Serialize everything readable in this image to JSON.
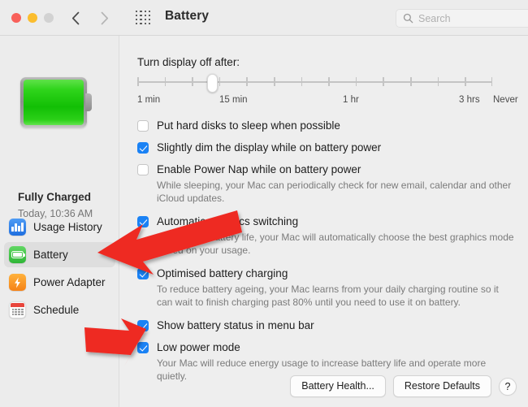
{
  "window": {
    "title": "Battery",
    "traffic_lights": [
      "close",
      "minimise",
      "zoom"
    ],
    "back_icon": "chevron-left-icon",
    "forward_icon": "chevron-right-icon",
    "grid_icon": "show-all-preferences-grid-icon",
    "search": {
      "placeholder": "Search",
      "value": "",
      "icon": "search-icon"
    }
  },
  "sidebar": {
    "battery_icon": "battery-full-green-icon",
    "status_title": "Fully Charged",
    "status_time": "Today, 10:36 AM",
    "items": [
      {
        "label": "Usage History",
        "icon": "usage-history-chart-icon",
        "selected": false
      },
      {
        "label": "Battery",
        "icon": "battery-icon",
        "selected": true
      },
      {
        "label": "Power Adapter",
        "icon": "power-adapter-bolt-icon",
        "selected": false
      },
      {
        "label": "Schedule",
        "icon": "schedule-calendar-icon",
        "selected": false
      }
    ]
  },
  "main": {
    "slider": {
      "label": "Turn display off after:",
      "tick_labels": [
        "1 min",
        "15 min",
        "1 hr",
        "3 hrs",
        "Never"
      ],
      "tick_count": 14,
      "thumb_position_percent": 21,
      "value": "15 min"
    },
    "options": [
      {
        "label": "Put hard disks to sleep when possible",
        "checked": false,
        "help": ""
      },
      {
        "label": "Slightly dim the display while on battery power",
        "checked": true,
        "help": ""
      },
      {
        "label": "Enable Power Nap while on battery power",
        "checked": false,
        "help": "While sleeping, your Mac can periodically check for new email, calendar and other iCloud updates."
      },
      {
        "label": "Automatic graphics switching",
        "checked": true,
        "help": "To increase battery life, your Mac will automatically choose the best graphics mode based on your usage."
      },
      {
        "label": "Optimised battery charging",
        "checked": true,
        "help": "To reduce battery ageing, your Mac learns from your daily charging routine so it can wait to finish charging past 80% until you need to use it on battery."
      },
      {
        "label": "Show battery status in menu bar",
        "checked": true,
        "help": ""
      },
      {
        "label": "Low power mode",
        "checked": true,
        "help": "Your Mac will reduce energy usage to increase battery life and operate more quietly."
      }
    ],
    "footer": {
      "battery_health_label": "Battery Health...",
      "restore_defaults_label": "Restore Defaults",
      "help_label": "?"
    }
  },
  "annotations": {
    "arrow_color": "#ee2a24",
    "arrows": [
      {
        "name": "arrow-pointing-to-battery-sidebar-item",
        "target": "Battery"
      },
      {
        "name": "arrow-pointing-to-low-power-mode-checkbox",
        "target": "Low power mode"
      }
    ]
  },
  "colors": {
    "accent_blue": "#1a82f5",
    "battery_green": "#2fd41b",
    "window_bg": "#eeeeee",
    "sidebar_bg": "#ececec"
  }
}
